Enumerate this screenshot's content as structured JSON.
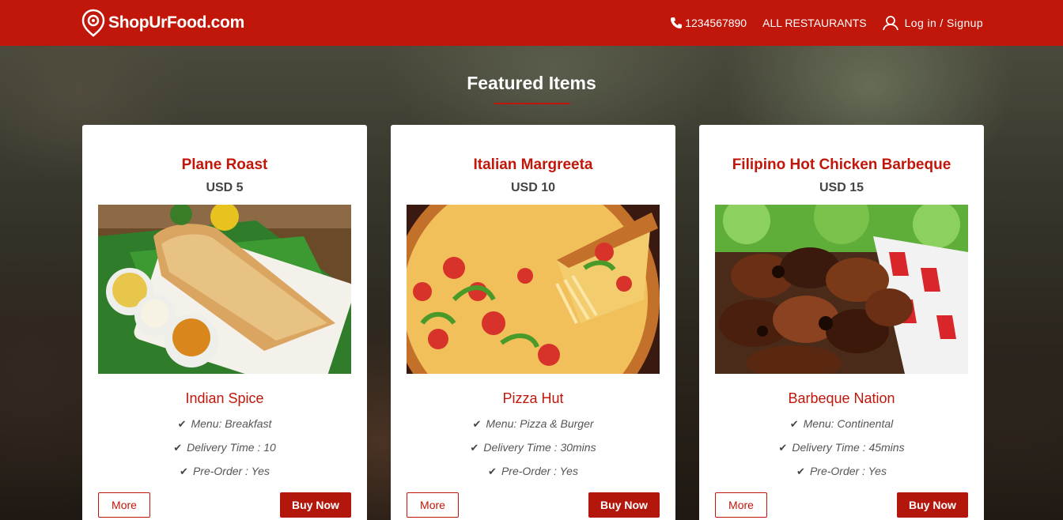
{
  "brand": {
    "name": "ShopUrFood.com"
  },
  "nav": {
    "phone": "1234567890",
    "restaurants_link": "ALL RESTAURANTS",
    "login_link": "Log in / Signup"
  },
  "section": {
    "title": "Featured Items"
  },
  "colors": {
    "brand_red": "#c0170a",
    "button_red": "#b3160a"
  },
  "cards": [
    {
      "title": "Plane Roast",
      "price": "USD 5",
      "image_icon": "dosa-image",
      "restaurant": "Indian Spice",
      "features": [
        "Menu: Breakfast",
        "Delivery Time : 10",
        "Pre-Order : Yes"
      ],
      "more_label": "More",
      "buy_label": "Buy Now"
    },
    {
      "title": "Italian Margreeta",
      "price": "USD 10",
      "image_icon": "pizza-image",
      "restaurant": "Pizza Hut",
      "features": [
        "Menu: Pizza & Burger",
        "Delivery Time : 30mins",
        "Pre-Order : Yes"
      ],
      "more_label": "More",
      "buy_label": "Buy Now"
    },
    {
      "title": "Filipino Hot Chicken Barbeque",
      "price": "USD 15",
      "image_icon": "barbeque-image",
      "restaurant": "Barbeque Nation",
      "features": [
        "Menu: Continental",
        "Delivery Time : 45mins",
        "Pre-Order : Yes"
      ],
      "more_label": "More",
      "buy_label": "Buy Now"
    }
  ]
}
